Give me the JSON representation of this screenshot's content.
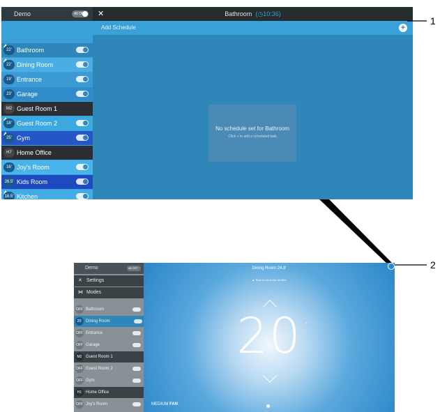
{
  "top": {
    "home_label": "Demo",
    "home_toggle": "All OFF",
    "title": "Bathroom",
    "time": "10:36",
    "add_schedule": "Add Schedule",
    "empty_title": "No schedule set for Bathroom",
    "empty_hint": "Click + to add a scheduled task",
    "rooms": [
      {
        "badge": "22'",
        "name": "Bathroom",
        "toggle": "ON"
      },
      {
        "badge": "22'",
        "name": "Dining Room",
        "toggle": "ON"
      },
      {
        "badge": "19'",
        "name": "Entrance",
        "toggle": "ON"
      },
      {
        "badge": "23'",
        "name": "Garage",
        "toggle": "ON"
      },
      {
        "badge": "M2",
        "name": "Guest Room 1",
        "toggle": ""
      },
      {
        "badge": "18'",
        "name": "Guest Room 2",
        "toggle": "ON"
      },
      {
        "badge": "25'",
        "name": "Gym",
        "toggle": "ON"
      },
      {
        "badge": "H7",
        "name": "Home Office",
        "toggle": ""
      },
      {
        "badge": "16'",
        "name": "Joy's Room",
        "toggle": "ON"
      },
      {
        "badge": "26.5'",
        "name": "Kids Room",
        "toggle": "ON"
      },
      {
        "badge": "16.5'",
        "name": "Kitchen",
        "toggle": "ON"
      }
    ]
  },
  "callouts": {
    "one": "1",
    "two": "2"
  },
  "bottom": {
    "home_label": "Demo",
    "home_toggle": "All OFF",
    "menu_settings": "Settings",
    "menu_modes": "Modes",
    "title": "Dining Room",
    "title_sub": "24.8'",
    "hint": "Time to clean the air filter",
    "temperature": "20",
    "degree": "°",
    "fan_mode": "MEDIUM",
    "fan_label": "FAN",
    "rooms": [
      {
        "badge": "OFF",
        "name": "Bathroom"
      },
      {
        "badge": "20'",
        "name": "Dining Room"
      },
      {
        "badge": "OFF",
        "name": "Entrance"
      },
      {
        "badge": "OFF",
        "name": "Garage"
      },
      {
        "badge": "M2",
        "name": "Guest Room 1"
      },
      {
        "badge": "OFF",
        "name": "Guest Room 2"
      },
      {
        "badge": "OFF",
        "name": "Gym"
      },
      {
        "badge": "H1",
        "name": "Home Office"
      },
      {
        "badge": "OFF",
        "name": "Joy's Room"
      }
    ]
  },
  "colors": {
    "accent": "#3aa0d8",
    "dark": "#2b2f33"
  }
}
